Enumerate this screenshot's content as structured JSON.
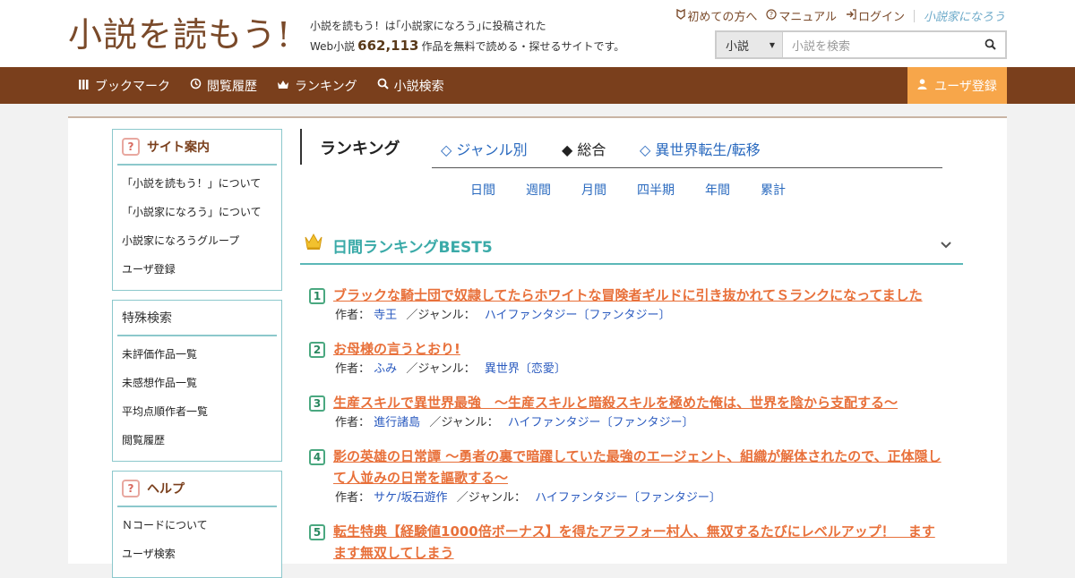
{
  "header": {
    "logo": "小説を読もう!",
    "tagline_line1": "小説を読もう！は｢小説家になろう｣に投稿された",
    "tagline_prefix": "Web小説",
    "work_count": "662,113",
    "tagline_suffix": "作品を無料で読める・探せるサイトです。",
    "links": [
      {
        "icon": "beginner-icon",
        "label": "初めての方へ"
      },
      {
        "icon": "help-circle-icon",
        "label": "マニュアル"
      },
      {
        "icon": "login-icon",
        "label": "ログイン"
      }
    ],
    "partner_logo": "小説家になろう",
    "search": {
      "select_value": "小説",
      "placeholder": "小説を検索",
      "icon": "search-icon"
    }
  },
  "nav": {
    "items": [
      {
        "icon": "bookmark-icon",
        "label": "ブックマーク"
      },
      {
        "icon": "history-icon",
        "label": "閲覧履歴"
      },
      {
        "icon": "crown-icon",
        "label": "ランキング"
      },
      {
        "icon": "search-icon",
        "label": "小説検索"
      }
    ],
    "register": {
      "icon": "user-icon",
      "label": "ユーザ登録"
    }
  },
  "sidebar": {
    "sections": [
      {
        "title": "サイト案内",
        "icon": "question-icon",
        "items": [
          "「小説を読もう！」について",
          "「小説家になろう」について",
          "小説家になろうグループ",
          "ユーザ登録"
        ]
      },
      {
        "title": "特殊検索",
        "icon": "",
        "items": [
          "未評価作品一覧",
          "未感想作品一覧",
          "平均点順作者一覧",
          "閲覧履歴"
        ]
      },
      {
        "title": "ヘルプ",
        "icon": "question-icon",
        "items": [
          "Ｎコードについて",
          "ユーザ検索"
        ]
      }
    ]
  },
  "ranking": {
    "title": "ランキング",
    "tabs": [
      {
        "label": "◇ ジャンル別",
        "active": false
      },
      {
        "label": "◆ 総合",
        "active": true
      },
      {
        "label": "◇ 異世界転生/転移",
        "active": false
      }
    ],
    "periods": [
      "日間",
      "週間",
      "月間",
      "四半期",
      "年間",
      "累計"
    ],
    "best_title": "日間ランキングBEST5",
    "author_label": "作者：",
    "genre_label": "／ジャンル：",
    "entries": [
      {
        "rank": "1",
        "title": "ブラックな騎士団で奴隷してたらホワイトな冒険者ギルドに引き抜かれてＳランクになってました",
        "author": "寺王",
        "genre": "ハイファンタジー〔ファンタジー〕"
      },
      {
        "rank": "2",
        "title": "お母様の言うとおり!",
        "author": "ふみ",
        "genre": "異世界〔恋愛〕"
      },
      {
        "rank": "3",
        "title": "生産スキルで異世界最強　～生産スキルと暗殺スキルを極めた俺は、世界を陰から支配する～",
        "author": "進行諸島",
        "genre": "ハイファンタジー〔ファンタジー〕"
      },
      {
        "rank": "4",
        "title": "影の英雄の日常譚 ～勇者の裏で暗躍していた最強のエージェント、組織が解体されたので、正体隠して人並みの日常を謳歌する～",
        "author": "サケ/坂石遊作",
        "genre": "ハイファンタジー〔ファンタジー〕"
      },
      {
        "rank": "5",
        "title": "転生特典【経験値1000倍ボーナス】を得たアラフォー村人、無双するたびにレベルアップ！　ますます無双してしまう",
        "author": "",
        "genre": ""
      }
    ]
  },
  "colors": {
    "brand_brown": "#7a3f1c",
    "register_orange": "#f7a64a",
    "teal": "#3aaaa8",
    "title_orange": "#e8703a",
    "link_blue": "#2a5abf"
  }
}
